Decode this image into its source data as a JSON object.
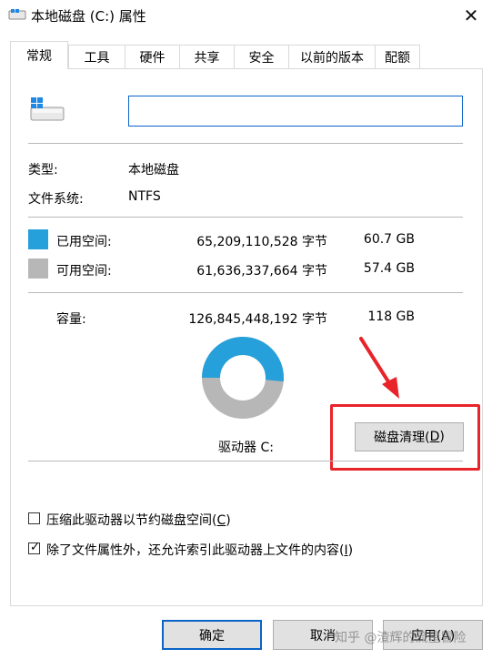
{
  "window": {
    "title": "本地磁盘 (C:) 属性",
    "close_glyph": "✕"
  },
  "tabs": [
    "常规",
    "工具",
    "硬件",
    "共享",
    "安全",
    "以前的版本",
    "配额"
  ],
  "general": {
    "name_value": "",
    "type_label": "类型:",
    "type_value": "本地磁盘",
    "fs_label": "文件系统:",
    "fs_value": "NTFS",
    "used_label": "已用空间:",
    "used_bytes": "65,209,110,528 字节",
    "used_size": "60.7 GB",
    "free_label": "可用空间:",
    "free_bytes": "61,636,337,664 字节",
    "free_size": "57.4 GB",
    "cap_label": "容量:",
    "cap_bytes": "126,845,448,192 字节",
    "cap_size": "118 GB",
    "drive_label": "驱动器 C:",
    "cleanup_text": "磁盘清理(",
    "cleanup_key": "D",
    "cleanup_close": ")",
    "compress_text": "压缩此驱动器以节约磁盘空间(",
    "compress_key": "C",
    "compress_close": ")",
    "compress_checked": false,
    "index_text": "除了文件属性外，还允许索引此驱动器上文件的内容(",
    "index_key": "I",
    "index_close": ")",
    "index_checked": true
  },
  "usage": {
    "used_fraction": 0.514
  },
  "colors": {
    "used": "#26a0da",
    "free": "#b7b7b7",
    "highlight": "#e8242a",
    "accent": "#0a64c8"
  },
  "buttons": {
    "ok": "确定",
    "cancel": "取消",
    "apply": "应用(A)"
  },
  "watermark": "知乎 @渣辉的流星冒险"
}
